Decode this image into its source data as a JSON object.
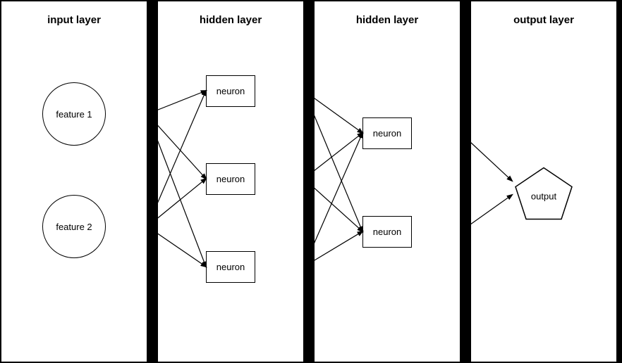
{
  "layers": [
    {
      "id": "input",
      "title": "input layer",
      "nodes": [
        {
          "label": "feature 1"
        },
        {
          "label": "feature 2"
        }
      ]
    },
    {
      "id": "hidden1",
      "title": "hidden layer",
      "nodes": [
        {
          "label": "neuron"
        },
        {
          "label": "neuron"
        },
        {
          "label": "neuron"
        }
      ]
    },
    {
      "id": "hidden2",
      "title": "hidden layer",
      "nodes": [
        {
          "label": "neuron"
        },
        {
          "label": "neuron"
        }
      ]
    },
    {
      "id": "output",
      "title": "output layer",
      "nodes": [
        {
          "label": "output"
        }
      ]
    }
  ]
}
